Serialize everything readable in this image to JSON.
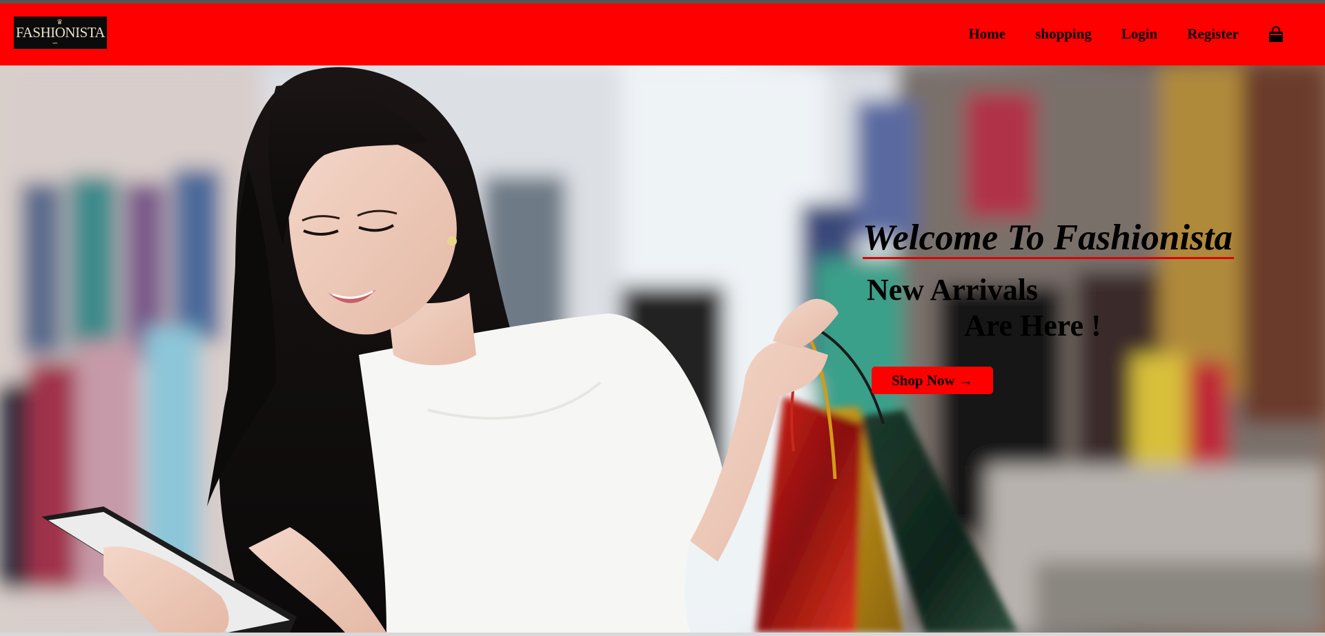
{
  "brand": {
    "logo_text": "FASHIONISTA"
  },
  "nav": {
    "items": [
      {
        "label": "Home"
      },
      {
        "label": "shopping"
      },
      {
        "label": "Login"
      },
      {
        "label": "Register"
      }
    ],
    "cart_icon": "shopping-bag-icon"
  },
  "hero": {
    "title": "Welcome To Fashionista",
    "line1": "New Arrivals",
    "line2": "Are Here !",
    "cta_label": "Shop Now →",
    "image": "woman-with-shopping-bags-photo"
  },
  "colors": {
    "navbar": "#ff0000",
    "button": "#ff0000",
    "title_underline": "#e00000",
    "logo_bg": "#0b0b0b"
  }
}
